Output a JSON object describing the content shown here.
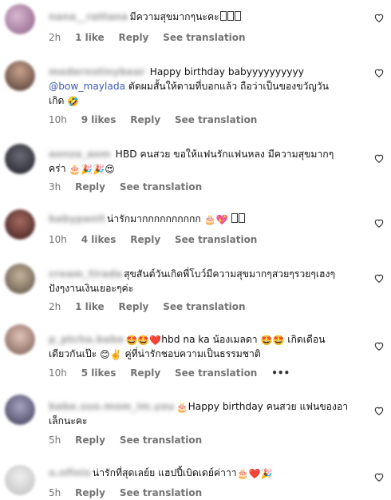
{
  "comments": [
    {
      "username": "nana__rattana",
      "text": "มีความสุขมากๆนะคะ",
      "trailing_boxes": 3,
      "time": "2h",
      "likes": "1 like",
      "reply": "Reply",
      "see_translation": "See translation",
      "avatar_color": "#b78bb2"
    },
    {
      "username": "modernstinybear",
      "text_line1": "Happy birthday babyyyyyyyyyy",
      "mention": "@bow_maylada",
      "text_line2": " ตัดผมสั้นให้ตามที่บอกแล้ว ถือว่าเป็นของขวัญวัน",
      "text_line3": "เกิด",
      "emoji_after": "🤣",
      "time": "10h",
      "likes": "9 likes",
      "reply": "Reply",
      "see_translation": "See translation",
      "avatar_color": "#8a6a5a"
    },
    {
      "username": "aonza_aom",
      "text_line1": "HBD คนสวย ขอให้แฟนรักแฟนหลง มีความสุขมากๆ",
      "text_line2": "คร่า",
      "emoji_after": "🎂🎉🎉😍",
      "time": "3h",
      "reply": "Reply",
      "see_translation": "See translation",
      "avatar_color": "#3a3a44"
    },
    {
      "username": "babypanit",
      "text": "น่ารักมากกกกกกกกกก",
      "emoji_after": "🎂💖",
      "trailing_boxes": 2,
      "time": "10h",
      "likes": "4 likes",
      "reply": "Reply",
      "see_translation": "See translation",
      "avatar_color": "#6a3b3b"
    },
    {
      "username": "cream_tirada",
      "text_line1": "สุขสันต์วันเกิดพี่โบว์มีความสุขมากๆสวยๆรวยๆเฮงๆ",
      "text_line2": "ปังๆงานเงินเยอะๆค่ะ",
      "time": "2h",
      "likes": "1 like",
      "reply": "Reply",
      "see_translation": "See translation",
      "avatar_color": "#8b7d69"
    },
    {
      "username": "p_ptcha.babe",
      "emoji_before": "🤩🤩❤️",
      "text_line1": "hbd na ka น้องเมลดา",
      "emoji_mid": "🤩🤩",
      "text_line1b": "เกิดเดือน",
      "text_line2a": "เดียวกันเป๊ะ",
      "emoji_line2": "😊✌️",
      "text_line2b": "คู่ที่น่ารักชอบความเป็นธรรมชาติ",
      "time": "10h",
      "likes": "5 likes",
      "reply": "Reply",
      "see_translation": "See translation",
      "more": "•••",
      "avatar_color": "#b08a80"
    },
    {
      "username": "babe.suo.mom_im.you",
      "emoji_before": "🎂",
      "text_line1": "Happy birthday คนสวย แฟนของอา",
      "text_line2": "เล็กนะคะ",
      "time": "5h",
      "reply": "Reply",
      "see_translation": "See translation",
      "avatar_color": "#6d6a86"
    },
    {
      "username": "o.nfinis",
      "text": "น่ารักที่สุดเลย์ย แฮปปี้เบิดเดย์ค่าาา",
      "emoji_after": "🎂❤️🎉",
      "time": "5h",
      "reply": "Reply",
      "see_translation": "See translation",
      "avatar_color": "#d9d9d9"
    }
  ]
}
